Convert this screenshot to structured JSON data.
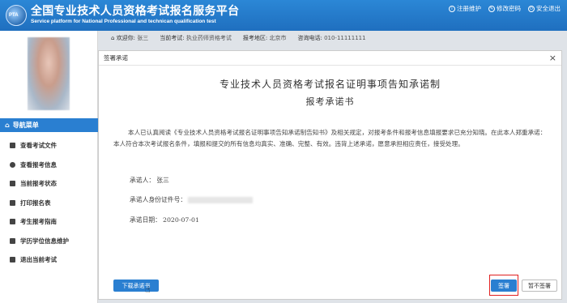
{
  "header": {
    "logo_text": "PTA",
    "title": "全国专业技术人员资格考试报名服务平台",
    "subtitle": "Service platform for National Professional and technican qualification test",
    "links": [
      {
        "label": "注册维护",
        "icon": "info-icon"
      },
      {
        "label": "修改密码",
        "icon": "edit-icon"
      },
      {
        "label": "安全退出",
        "icon": "logout-icon"
      }
    ]
  },
  "infobar": {
    "welcome_label": "欢迎你:",
    "welcome_value": "张三",
    "exam_label": "当前考试:",
    "exam_value": "执业药师资格考试",
    "region_label": "报考地区:",
    "region_value": "北京市",
    "phone_label": "咨询电话:",
    "phone_value": "010-11111111"
  },
  "sidebar": {
    "nav_head": "导航菜单",
    "items": [
      {
        "label": "查看考试文件",
        "icon": "document-icon"
      },
      {
        "label": "查看报考信息",
        "icon": "eye-icon"
      },
      {
        "label": "当前报考状态",
        "icon": "monitor-icon"
      },
      {
        "label": "打印报名表",
        "icon": "print-icon"
      },
      {
        "label": "考生报考指南",
        "icon": "book-icon"
      },
      {
        "label": "学历学位信息维护",
        "icon": "graduation-icon"
      },
      {
        "label": "退出当前考试",
        "icon": "exit-icon"
      }
    ]
  },
  "modal": {
    "title": "签署承诺",
    "doc_title": "专业技术人员资格考试报名证明事项告知承诺制",
    "doc_subtitle": "报考承诺书",
    "body": "本人已认真阅读《专业技术人员资格考试报名证明事项告知承诺制告知书》及相关规定，对报考条件和报考信息填报要求已充分知晓。在此本人郑重承诺：本人符合本次考试报名条件，填报和提交的所有信息均真实、准确、完整、有效。违背上述承诺，愿意承担相应责任，接受处理。",
    "promiser_label": "承诺人：",
    "promiser_value": "张三",
    "id_label": "承诺人身份证件号：",
    "date_label": "承诺日期：",
    "date_value": "2020-07-01",
    "download_label": "下载承诺书",
    "sign_label": "签署",
    "nosign_label": "暂不签署"
  }
}
